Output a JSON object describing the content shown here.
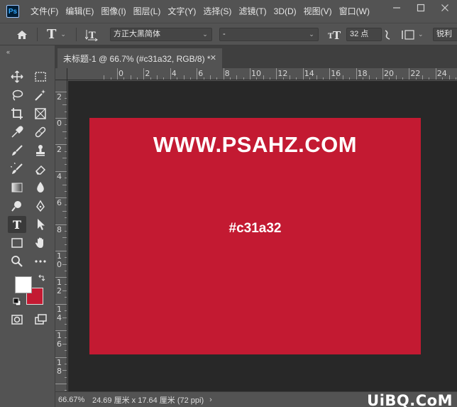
{
  "menubar": {
    "logo": "Ps",
    "items": [
      "文件(F)",
      "编辑(E)",
      "图像(I)",
      "图层(L)",
      "文字(Y)",
      "选择(S)",
      "滤镜(T)",
      "3D(D)",
      "视图(V)",
      "窗口(W)"
    ],
    "window_controls": [
      "minimize-icon",
      "maximize-icon",
      "close-icon"
    ]
  },
  "options": {
    "font_family": "方正大黑简体",
    "font_style": "-",
    "font_size": "32 点",
    "antialias": "锐利"
  },
  "toolbar": {
    "tools": [
      "move-icon",
      "marquee-icon",
      "lasso-icon",
      "magic-wand-icon",
      "crop-icon",
      "frame-icon",
      "eyedropper-icon",
      "healing-brush-icon",
      "brush-icon",
      "clone-stamp-icon",
      "history-brush-icon",
      "eraser-icon",
      "gradient-icon",
      "blur-icon",
      "dodge-icon",
      "pen-icon",
      "type-icon",
      "path-selection-icon",
      "rectangle-icon",
      "hand-icon",
      "zoom-icon",
      "more-tools-icon"
    ],
    "active_tool": "type-icon",
    "foreground_color": "#ffffff",
    "background_color": "#c31a32"
  },
  "document": {
    "tab_title": "未标题-1 @ 66.7% (#c31a32, RGB/8) *",
    "canvas_color": "#c31a32",
    "headline": "WWW.PSAHZ.COM",
    "hex_label": "#c31a32"
  },
  "rulers": {
    "horizontal_labels": [
      "0",
      "2",
      "4",
      "6",
      "8",
      "10",
      "12",
      "14",
      "16",
      "18",
      "20",
      "22",
      "24"
    ],
    "vertical_labels": [
      "2",
      "0",
      "2",
      "4",
      "6",
      "8",
      "1\n0",
      "1\n2",
      "1\n4",
      "1\n6",
      "1\n8"
    ]
  },
  "status": {
    "zoom": "66.67%",
    "doc_size": "24.69 厘米 x 17.64 厘米 (72 ppi)",
    "arrow": "›"
  },
  "watermark": "UiBQ.CoM"
}
